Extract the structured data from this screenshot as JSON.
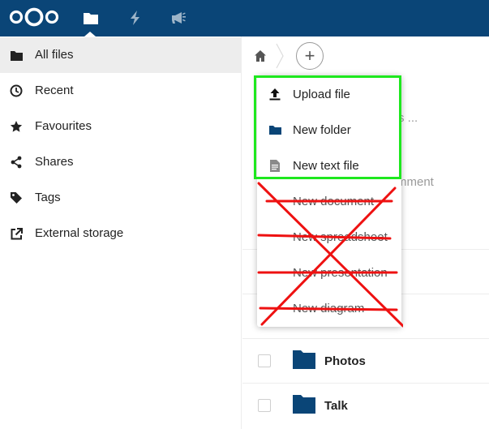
{
  "header": {
    "logo_icon": "nextcloud-logo",
    "nav": [
      {
        "icon": "folder-icon",
        "active": true
      },
      {
        "icon": "lightning-icon",
        "active": false
      },
      {
        "icon": "megaphone-icon",
        "active": false
      }
    ],
    "bg_color": "#0a4577"
  },
  "sidebar": {
    "items": [
      {
        "label": "All files",
        "icon": "folder-icon",
        "active": true
      },
      {
        "label": "Recent",
        "icon": "clock-icon",
        "active": false
      },
      {
        "label": "Favourites",
        "icon": "star-icon",
        "active": false
      },
      {
        "label": "Shares",
        "icon": "share-icon",
        "active": false
      },
      {
        "label": "Tags",
        "icon": "tag-icon",
        "active": false
      },
      {
        "label": "External storage",
        "icon": "external-link-icon",
        "active": false
      }
    ]
  },
  "breadcrumb": {
    "home_icon": "home-icon",
    "add_label": "+"
  },
  "background_text": {
    "partial_1": "s ...",
    "partial_2": "mment"
  },
  "files": [
    {
      "name": "Photos",
      "icon": "folder-icon"
    },
    {
      "name": "Talk",
      "icon": "folder-icon"
    }
  ],
  "new_menu": {
    "items": [
      {
        "label": "Upload file",
        "icon": "upload-icon",
        "crossed": false
      },
      {
        "label": "New folder",
        "icon": "folder-icon",
        "crossed": false
      },
      {
        "label": "New text file",
        "icon": "text-file-icon",
        "crossed": false
      },
      {
        "label": "New document",
        "icon": "",
        "crossed": true
      },
      {
        "label": "New spreadsheet",
        "icon": "",
        "crossed": true
      },
      {
        "label": "New presentation",
        "icon": "",
        "crossed": true
      },
      {
        "label": "New diagram",
        "icon": "",
        "crossed": true
      }
    ]
  },
  "annotation_colors": {
    "highlight": "#1ee81e",
    "cross": "#ee1111"
  }
}
